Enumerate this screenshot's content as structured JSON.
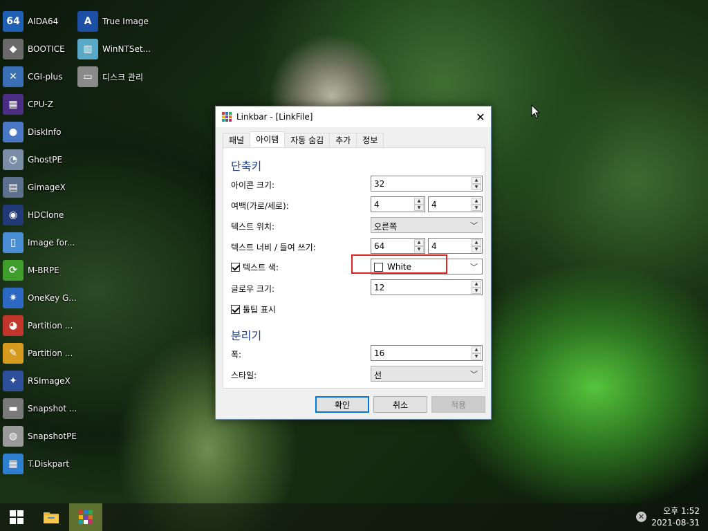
{
  "desktop": {
    "icons_col1": [
      {
        "label": "AIDA64",
        "icon": "aida64-icon",
        "glyph": "64",
        "color": "#1f5fb4"
      },
      {
        "label": "BOOTICE",
        "icon": "bootice-icon",
        "glyph": "◆",
        "color": "#6a6a6a"
      },
      {
        "label": "CGI-plus",
        "icon": "cgi-plus-icon",
        "glyph": "✕",
        "color": "#3b6fb5"
      },
      {
        "label": "CPU-Z",
        "icon": "cpu-z-icon",
        "glyph": "▦",
        "color": "#4b2e83"
      },
      {
        "label": "DiskInfo",
        "icon": "diskinfo-icon",
        "glyph": "●",
        "color": "#4a78c4"
      },
      {
        "label": "GhostPE",
        "icon": "ghostpe-icon",
        "glyph": "◔",
        "color": "#7a8ea8"
      },
      {
        "label": "GimageX",
        "icon": "gimagex-icon",
        "glyph": "▤",
        "color": "#5c7090"
      },
      {
        "label": "HDClone",
        "icon": "hdclone-icon",
        "glyph": "◉",
        "color": "#203a78"
      },
      {
        "label": "Image for...",
        "icon": "image-for-icon",
        "glyph": "▯",
        "color": "#4a8fd6"
      },
      {
        "label": "M-BRPE",
        "icon": "m-brpe-icon",
        "glyph": "⟳",
        "color": "#3f9d2b"
      },
      {
        "label": "OneKey G...",
        "icon": "onekey-ghost-icon",
        "glyph": "✷",
        "color": "#2d68c2"
      },
      {
        "label": "Partition ...",
        "icon": "partition-1-icon",
        "glyph": "◕",
        "color": "#c2352b"
      },
      {
        "label": "Partition ...",
        "icon": "partition-2-icon",
        "glyph": "✎",
        "color": "#d69b1e"
      },
      {
        "label": "RSImageX",
        "icon": "rsimagex-icon",
        "glyph": "✦",
        "color": "#2e4f9a"
      },
      {
        "label": "Snapshot ...",
        "icon": "snapshot-icon",
        "glyph": "▬",
        "color": "#7a7a7a"
      },
      {
        "label": "SnapshotPE",
        "icon": "snapshotpe-icon",
        "glyph": "◍",
        "color": "#9a9a9a"
      },
      {
        "label": "T.Diskpart",
        "icon": "t-diskpart-icon",
        "glyph": "▦",
        "color": "#2f7fd0"
      }
    ],
    "icons_col2": [
      {
        "label": "True Image",
        "icon": "true-image-icon",
        "glyph": "A",
        "color": "#1e4fa6"
      },
      {
        "label": "WinNTSet...",
        "icon": "winntsetup-icon",
        "glyph": "▥",
        "color": "#5aa8c8"
      },
      {
        "label": "디스크 관리",
        "icon": "disk-management-icon",
        "glyph": "▭",
        "color": "#8a8a8a"
      }
    ]
  },
  "dialog": {
    "title": "Linkbar - [LinkFile]",
    "close_glyph": "✕",
    "tabs": [
      "패널",
      "아이템",
      "자동 숨김",
      "추가",
      "정보"
    ],
    "shortcut_section": "단축키",
    "icon_size_label": "아이콘 크기:",
    "icon_size_value": "32",
    "margin_label": "여백(가로/세로):",
    "margin_h": "4",
    "margin_v": "4",
    "text_position_label": "텍스트 위치:",
    "text_position_value": "오른쪽",
    "text_width_label": "텍스트 너비 / 들여 쓰기:",
    "text_width_value": "64",
    "indent_value": "4",
    "text_color_label": "텍스트 색:",
    "text_color_value": "White",
    "glow_size_label": "글로우 크기:",
    "glow_size_value": "12",
    "tooltip_label": "툴팁 표시",
    "separator_section": "분리기",
    "width_label": "폭:",
    "width_value": "16",
    "style_label": "스타일:",
    "style_value": "선",
    "ok_label": "확인",
    "cancel_label": "취소",
    "apply_label": "적용",
    "highlight_color": "#e02020",
    "accent_color": "#0078d7"
  },
  "taskbar": {
    "time": "오후 1:52",
    "date": "2021-08-31"
  }
}
